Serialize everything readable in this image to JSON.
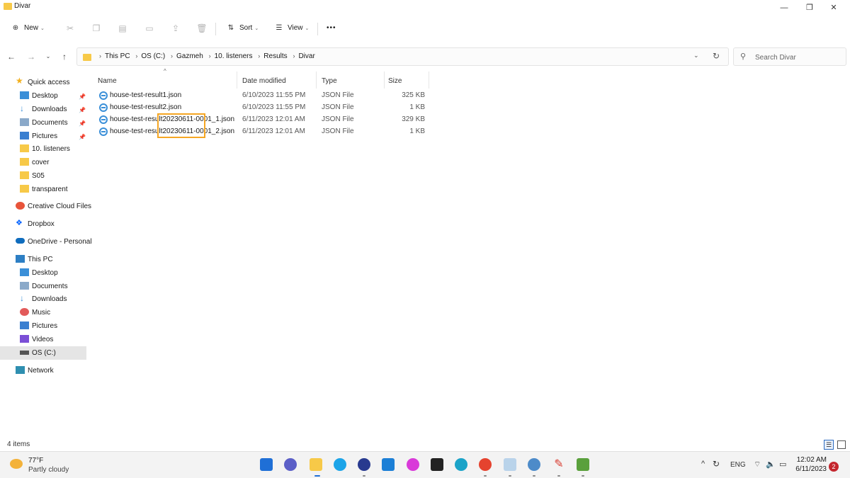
{
  "window": {
    "title": "Divar"
  },
  "toolbar": {
    "new_label": "New",
    "sort_label": "Sort",
    "view_label": "View",
    "more_label": "•••"
  },
  "breadcrumb": [
    "This PC",
    "OS (C:)",
    "Gazmeh",
    "10. listeners",
    "Results",
    "Divar"
  ],
  "search": {
    "placeholder": "Search Divar"
  },
  "sidebar": {
    "quick_access": "Quick access",
    "pinned": [
      "Desktop",
      "Downloads",
      "Documents",
      "Pictures"
    ],
    "recent": [
      "10. listeners",
      "cover",
      "S05",
      "transparent"
    ],
    "creative_cloud": "Creative Cloud Files",
    "dropbox": "Dropbox",
    "onedrive": "OneDrive - Personal",
    "this_pc": "This PC",
    "this_pc_items": [
      "Desktop",
      "Documents",
      "Downloads",
      "Music",
      "Pictures",
      "Videos",
      "OS (C:)"
    ],
    "network": "Network"
  },
  "columns": {
    "name": "Name",
    "date": "Date modified",
    "type": "Type",
    "size": "Size"
  },
  "files": [
    {
      "name": "house-test-result1.json",
      "date": "6/10/2023 11:55 PM",
      "type": "JSON File",
      "size": "325 KB"
    },
    {
      "name": "house-test-result2.json",
      "date": "6/10/2023 11:55 PM",
      "type": "JSON File",
      "size": "1 KB"
    },
    {
      "name": "house-test-result20230611-0001_1.json",
      "date": "6/11/2023 12:01 AM",
      "type": "JSON File",
      "size": "329 KB"
    },
    {
      "name": "house-test-result20230611-0001_2.json",
      "date": "6/11/2023 12:01 AM",
      "type": "JSON File",
      "size": "1 KB"
    }
  ],
  "status": {
    "items": "4 items"
  },
  "taskbar": {
    "weather_temp": "77°F",
    "weather_cond": "Partly cloudy",
    "lang": "ENG",
    "time": "12:02 AM",
    "date": "6/11/2023",
    "notifications": "2"
  },
  "colors": {
    "highlight": "#f5a623",
    "folder": "#f7c948",
    "selected_bg": "#e5e5e5"
  }
}
